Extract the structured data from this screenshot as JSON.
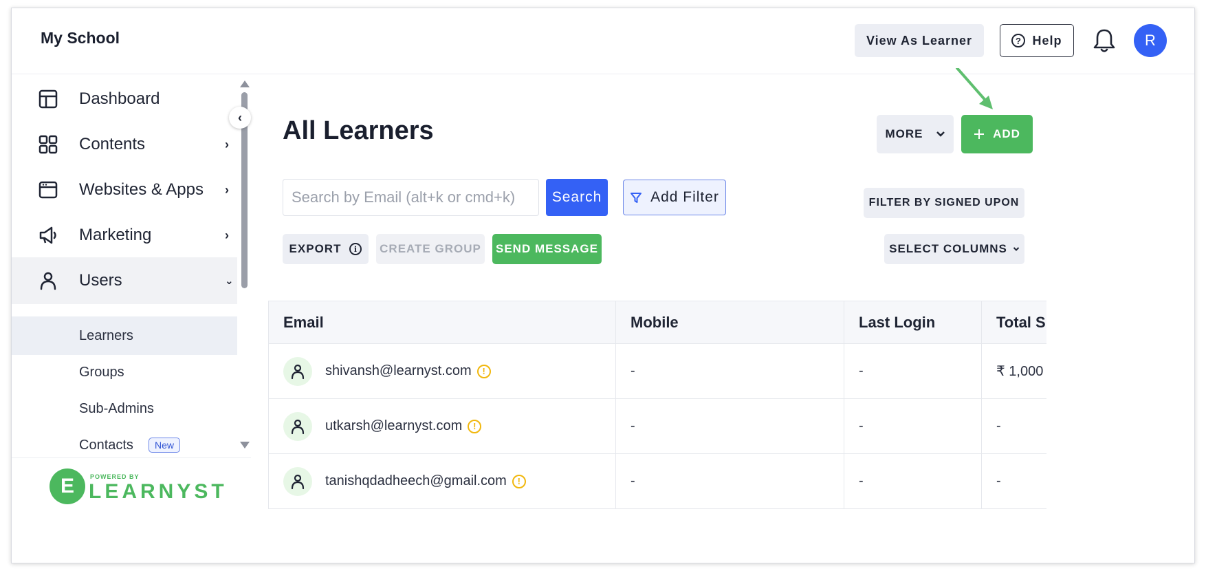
{
  "header": {
    "school_name": "My School",
    "view_as_learner": "View As Learner",
    "help": "Help",
    "avatar_initial": "R"
  },
  "sidebar": {
    "items": [
      {
        "label": "Dashboard",
        "icon": "layout-icon",
        "has_children": false
      },
      {
        "label": "Contents",
        "icon": "grid-icon",
        "has_children": true
      },
      {
        "label": "Websites & Apps",
        "icon": "browser-icon",
        "has_children": true
      },
      {
        "label": "Marketing",
        "icon": "megaphone-icon",
        "has_children": true
      },
      {
        "label": "Users",
        "icon": "user-icon",
        "has_children": true,
        "expanded": true
      }
    ],
    "sub_items": [
      {
        "label": "Learners",
        "selected": true
      },
      {
        "label": "Groups"
      },
      {
        "label": "Sub-Admins"
      },
      {
        "label": "Contacts",
        "badge": "New"
      }
    ],
    "footer": {
      "powered_by": "POWERED BY",
      "brand": "LEARNYST",
      "logo_letter": "E"
    }
  },
  "main": {
    "title": "All Learners",
    "more_label": "MORE",
    "add_label": "ADD",
    "search": {
      "placeholder": "Search by Email (alt+k or cmd+k)",
      "value": "",
      "button": "Search"
    },
    "add_filter": "Add Filter",
    "filter_signed": "FILTER BY SIGNED UPON",
    "export": "EXPORT",
    "create_group": "CREATE GROUP",
    "send_message": "SEND MESSAGE",
    "select_columns": "SELECT COLUMNS"
  },
  "table": {
    "columns": [
      "Email",
      "Mobile",
      "Last Login",
      "Total Sp"
    ],
    "rows": [
      {
        "email": "shivansh@learnyst.com",
        "mobile": "-",
        "last_login": "-",
        "total": "₹ 1,000"
      },
      {
        "email": "utkarsh@learnyst.com",
        "mobile": "-",
        "last_login": "-",
        "total": "-"
      },
      {
        "email": "tanishqdadheech@gmail.com",
        "mobile": "-",
        "last_login": "-",
        "total": "-"
      }
    ]
  },
  "colors": {
    "primary_blue": "#3461f5",
    "brand_green": "#4cb85e",
    "warning_yellow": "#f1b70d"
  }
}
